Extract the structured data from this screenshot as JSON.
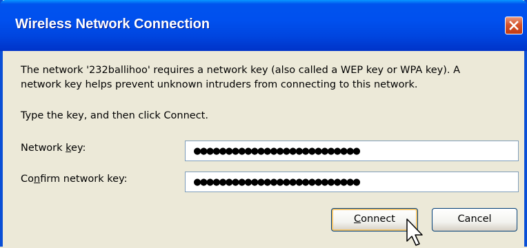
{
  "window": {
    "title": "Wireless Network Connection"
  },
  "message": {
    "line1": "The network '232ballihoo' requires a network key (also called a WEP key or WPA key). A",
    "line2": "network key helps prevent unknown intruders from connecting to this network.",
    "instruction": "Type the key, and then click Connect."
  },
  "form": {
    "network_key": {
      "label_pre": "Network ",
      "label_acc": "k",
      "label_post": "ey:",
      "value": "●●●●●●●●●●●●●●●●●●●●●●●●●●"
    },
    "confirm_key": {
      "label_pre": "Co",
      "label_acc": "n",
      "label_post": "firm network key:",
      "value": "●●●●●●●●●●●●●●●●●●●●●●●●●●"
    }
  },
  "buttons": {
    "connect": {
      "acc": "C",
      "rest": "onnect"
    },
    "cancel": {
      "label": "Cancel"
    }
  },
  "colors": {
    "titlebar": "#0054e3",
    "dialog_bg": "#ece9d8",
    "close": "#d5542b"
  }
}
